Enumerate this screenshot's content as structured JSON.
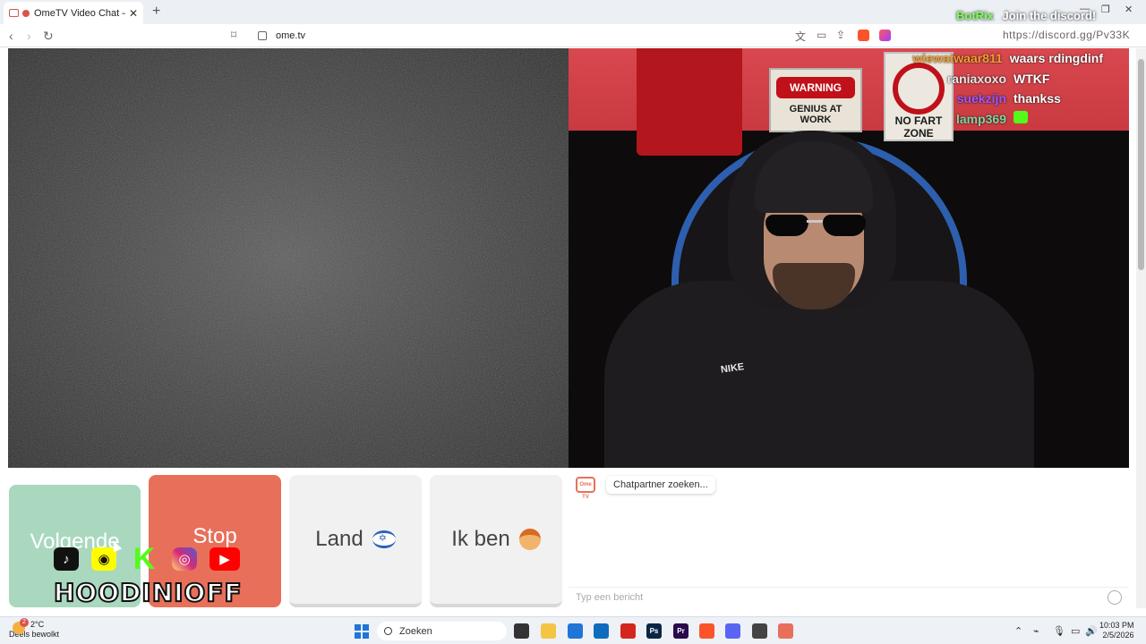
{
  "browser": {
    "tab_title": "OmeTV Video Chat — Omeg",
    "url": "ome.tv"
  },
  "stream_overlay": {
    "discord_bot": "BotRix",
    "discord_text": "Join the discord!",
    "discord_url": "https://discord.gg/Pv33K",
    "chat": [
      {
        "user": "wiewatwaar811",
        "message": "waars rdingdinf",
        "user_color": "#f0a030"
      },
      {
        "user": "raniaxoxo",
        "message": "WTKF",
        "user_color": "#e6e6e6"
      },
      {
        "user": "suekzijn",
        "message": "thankss",
        "user_color": "#9b59ff"
      },
      {
        "user": "lamp369",
        "message": "",
        "user_color": "#7dd3a0"
      }
    ],
    "socials": [
      "tiktok-icon",
      "snapchat-icon",
      "kick-icon",
      "instagram-icon",
      "youtube-icon"
    ],
    "brand": "HOODINIOFF"
  },
  "video": {
    "right_sign1": "WARNING",
    "right_sign1_sub": "GENIUS AT WORK",
    "right_sign2": "NO FART ZONE",
    "jacket_logo": "NIKE"
  },
  "controls": {
    "next_label": "Volgende",
    "stop_label": "Stop",
    "country_label": "Land",
    "gender_label": "Ik ben",
    "next_color": "#a9d8bf",
    "stop_color": "#e8705a"
  },
  "chat": {
    "logo_text": "Ome TV",
    "status": "Chatpartner zoeken...",
    "input_placeholder": "Typ een bericht"
  },
  "taskbar": {
    "weather_temp": "2°C",
    "weather_desc": "Deels bewolkt",
    "weather_badge": "2",
    "search_label": "Zoeken",
    "time": "10:03 PM",
    "date": "2/5/2026"
  }
}
